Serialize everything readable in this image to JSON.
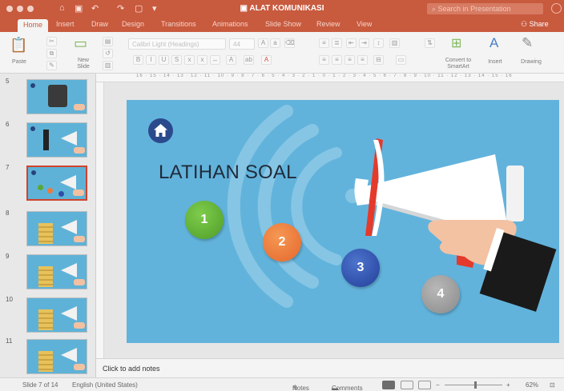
{
  "window": {
    "title": "ALAT KOMUNIKASI",
    "search_placeholder": "Search in Presentation"
  },
  "tabs": [
    {
      "label": "Home",
      "active": true
    },
    {
      "label": "Insert"
    },
    {
      "label": "Draw"
    },
    {
      "label": "Design"
    },
    {
      "label": "Transitions"
    },
    {
      "label": "Animations"
    },
    {
      "label": "Slide Show"
    },
    {
      "label": "Review"
    },
    {
      "label": "View"
    }
  ],
  "share_label": "Share",
  "ribbon": {
    "paste": "Paste",
    "new_slide_line1": "New",
    "new_slide_line2": "Slide",
    "font_name": "Calibri Light (Headings)",
    "font_size": "44",
    "convert_line1": "Convert to",
    "convert_line2": "SmartArt",
    "insert": "Insert",
    "drawing": "Drawing"
  },
  "ruler_text": "16 · 15 · 14 · 13 · 12 · 11 · 10 · 9 · 8 · 7 · 6 · 5 · 4 · 3 · 2 · 1 · 0 · 1 · 2 · 3 · 4 · 5 · 6 · 7 · 8 · 9 · 10 · 11 · 12 · 13 · 14 · 15 · 16",
  "thumbnails": [
    {
      "number": "5",
      "kind": "device"
    },
    {
      "number": "6",
      "kind": "radio"
    },
    {
      "number": "7",
      "kind": "circles",
      "selected": true
    },
    {
      "number": "8",
      "kind": "stack"
    },
    {
      "number": "9",
      "kind": "stack"
    },
    {
      "number": "10",
      "kind": "stack"
    },
    {
      "number": "11",
      "kind": "stack"
    }
  ],
  "slide": {
    "title": "LATIHAN SOAL",
    "bubbles": [
      "1",
      "2",
      "3",
      "4"
    ],
    "home_icon": "home-icon"
  },
  "notes_placeholder": "Click to add notes",
  "status": {
    "slide_position": "Slide 7 of 14",
    "language": "English (United States)",
    "notes": "Notes",
    "comments": "Comments",
    "zoom": "62%"
  },
  "colors": {
    "accent": "#c85a3e",
    "slide_bg": "#62b3dc",
    "selected_border": "#d0432c"
  }
}
